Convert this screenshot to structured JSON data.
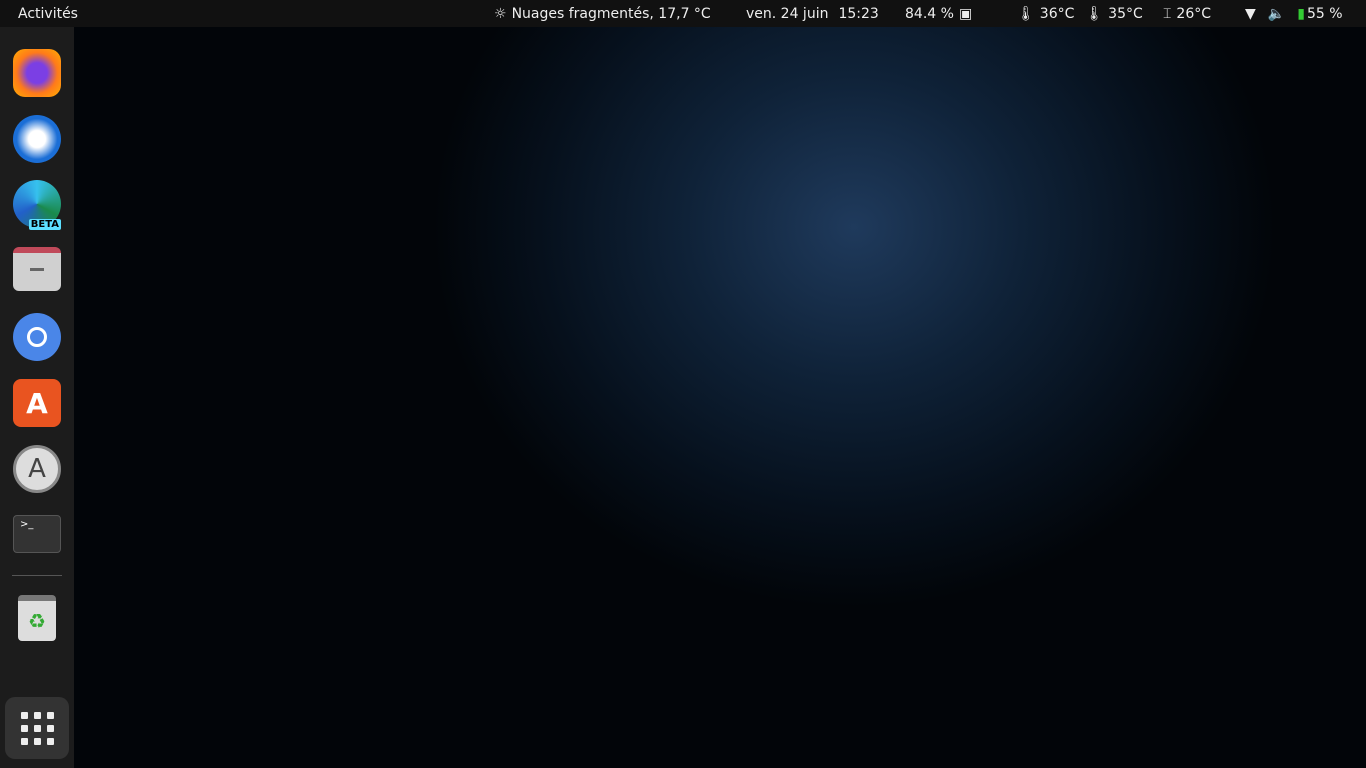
{
  "topbar": {
    "activities": "Activités",
    "weather": "Nuages fragmentés, 17,7 °C",
    "date": "ven. 24 juin",
    "time": "15:23",
    "cpu": "84.4 %",
    "temp1": "36°C",
    "temp2": "35°C",
    "temp3": "26°C",
    "battery": "55 %"
  },
  "dock": {
    "apps": [
      "Firefox",
      "Thunderbird",
      "Microsoft Edge Beta",
      "Files",
      "Chromium",
      "Ubuntu Software",
      "Software Updater",
      "Terminal",
      "Trash",
      "Show Applications"
    ],
    "edge_badge": "BETA"
  }
}
